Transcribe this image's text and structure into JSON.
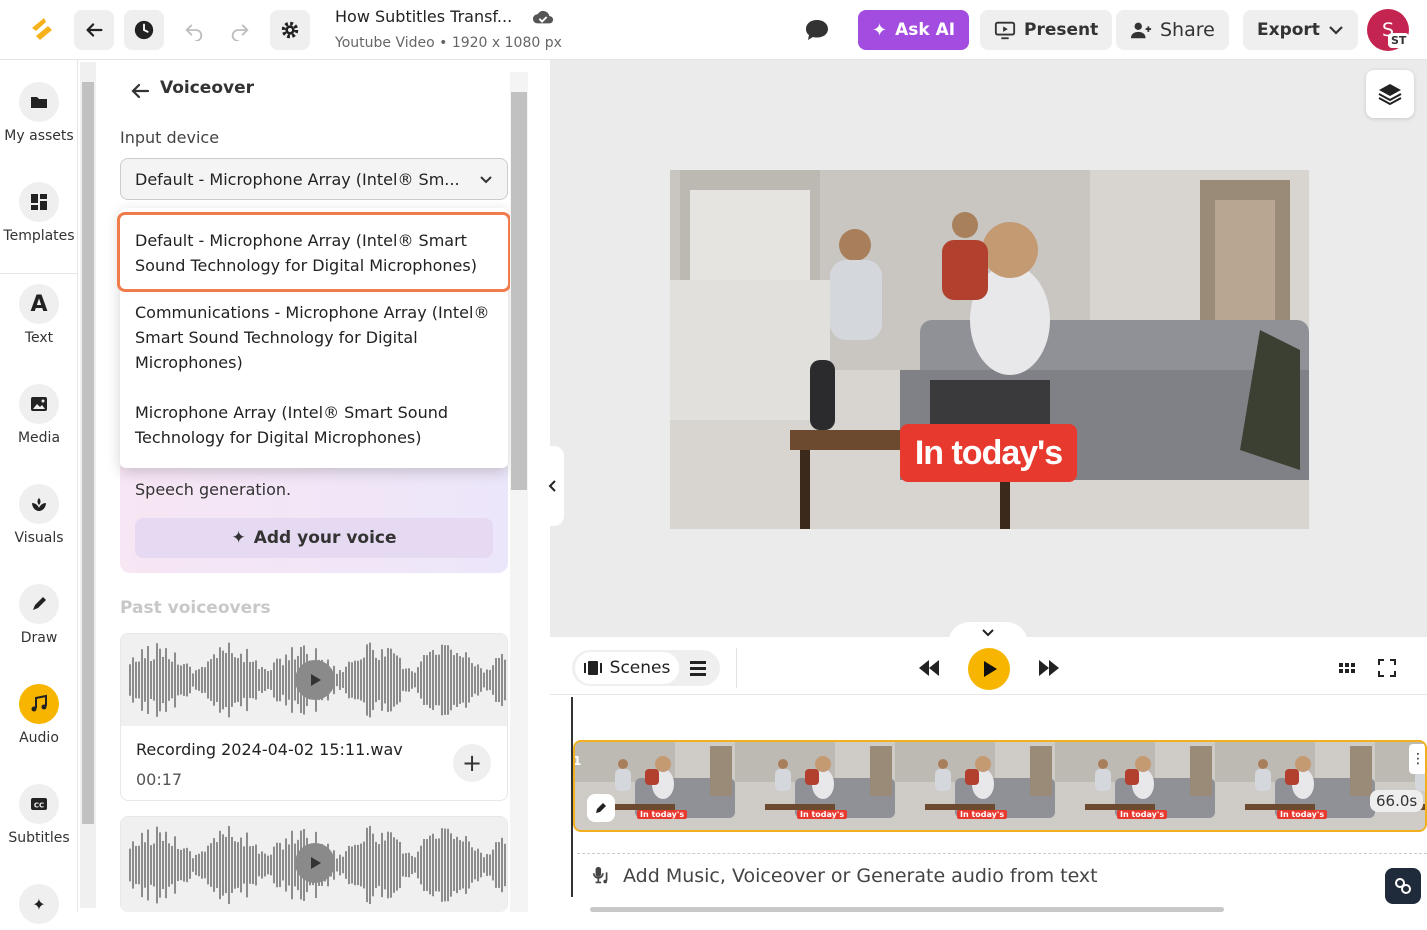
{
  "topbar": {
    "title": "How Subtitles Transf...",
    "subtitle": "Youtube Video • 1920 x 1080 px",
    "ask_ai": "Ask AI",
    "present": "Present",
    "share": "Share",
    "export": "Export",
    "avatar_initials": "ST",
    "avatar_letter": "S",
    "accent_color": "#a24de0"
  },
  "rail": {
    "items": [
      {
        "label": "My assets",
        "icon": "folder-icon"
      },
      {
        "label": "Templates",
        "icon": "templates-icon"
      },
      {
        "label": "Text",
        "icon": "text-icon"
      },
      {
        "label": "Media",
        "icon": "image-icon"
      },
      {
        "label": "Visuals",
        "icon": "visuals-icon"
      },
      {
        "label": "Draw",
        "icon": "pen-icon"
      },
      {
        "label": "Audio",
        "icon": "music-icon"
      },
      {
        "label": "Subtitles",
        "icon": "cc-icon"
      }
    ]
  },
  "panel": {
    "title": "Voiceover",
    "input_label": "Input device",
    "selected_device": "Default - Microphone Array (Intel® Sm...",
    "options": [
      "Default - Microphone Array (Intel® Smart Sound Technology for Digital Microphones)",
      "Communications - Microphone Array (Intel® Smart Sound Technology for Digital Microphones)",
      "Microphone Array (Intel® Smart Sound Technology for Digital Microphones)"
    ],
    "voice_desc": "Speech generation.",
    "add_voice": "Add your voice",
    "past_title": "Past voiceovers",
    "recordings": [
      {
        "name": "Recording 2024-04-02 15:11.wav",
        "duration": "00:17"
      }
    ]
  },
  "stage": {
    "caption": "In today's"
  },
  "controls": {
    "scenes_label": "Scenes"
  },
  "timeline": {
    "duration": "66.0s",
    "thumb_caption": "In today's",
    "audio_prompt": "Add Music, Voiceover or Generate audio from text"
  }
}
